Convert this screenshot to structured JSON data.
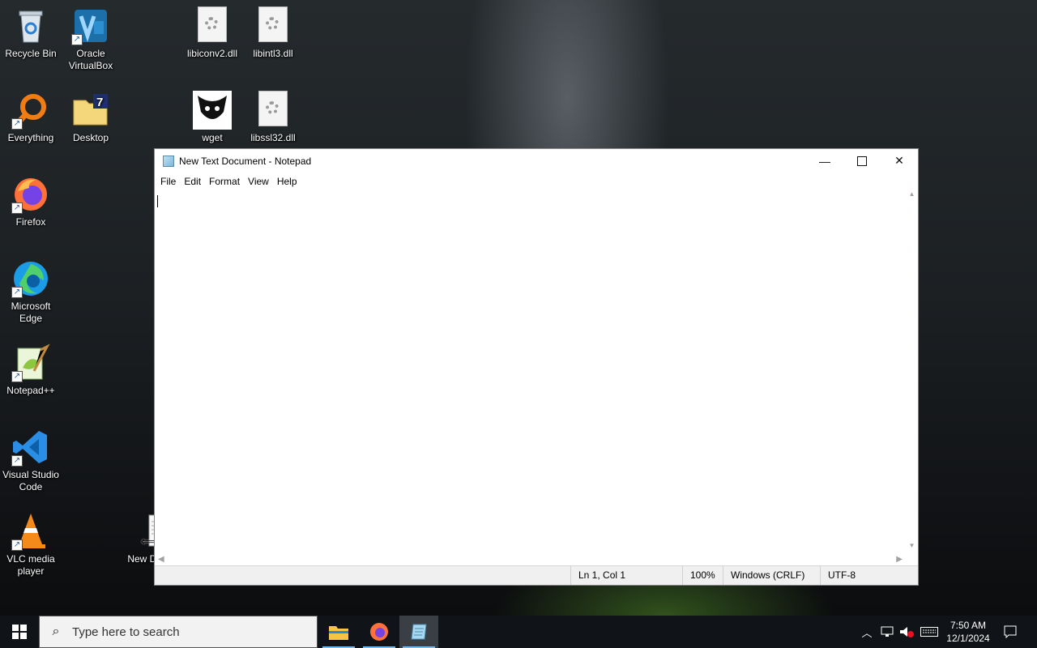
{
  "desktop": {
    "icons": [
      {
        "label": "Recycle Bin"
      },
      {
        "label": "Oracle VirtualBox"
      },
      {
        "label": "libiconv2.dll"
      },
      {
        "label": "libintl3.dll"
      },
      {
        "label": "Everything"
      },
      {
        "label": "Desktop"
      },
      {
        "label": "wget"
      },
      {
        "label": "libssl32.dll"
      },
      {
        "label": "Firefox"
      },
      {
        "label": "Microsoft Edge"
      },
      {
        "label": "Notepad++"
      },
      {
        "label": "Visual Studio Code"
      },
      {
        "label": "VLC media player"
      },
      {
        "label": "New Docu"
      }
    ]
  },
  "notepad": {
    "title": "New Text Document - Notepad",
    "menu": [
      "File",
      "Edit",
      "Format",
      "View",
      "Help"
    ],
    "content": "",
    "status": {
      "position": "Ln 1, Col 1",
      "zoom": "100%",
      "line_ending": "Windows (CRLF)",
      "encoding": "UTF-8"
    }
  },
  "taskbar": {
    "search_placeholder": "Type here to search",
    "apps": [
      "file-explorer",
      "firefox",
      "notepad"
    ],
    "time": "7:50 AM",
    "date": "12/1/2024"
  },
  "colors": {
    "taskbar": "#101317",
    "active_indicator": "#76b9ed",
    "window_bg": "#ffffff"
  }
}
